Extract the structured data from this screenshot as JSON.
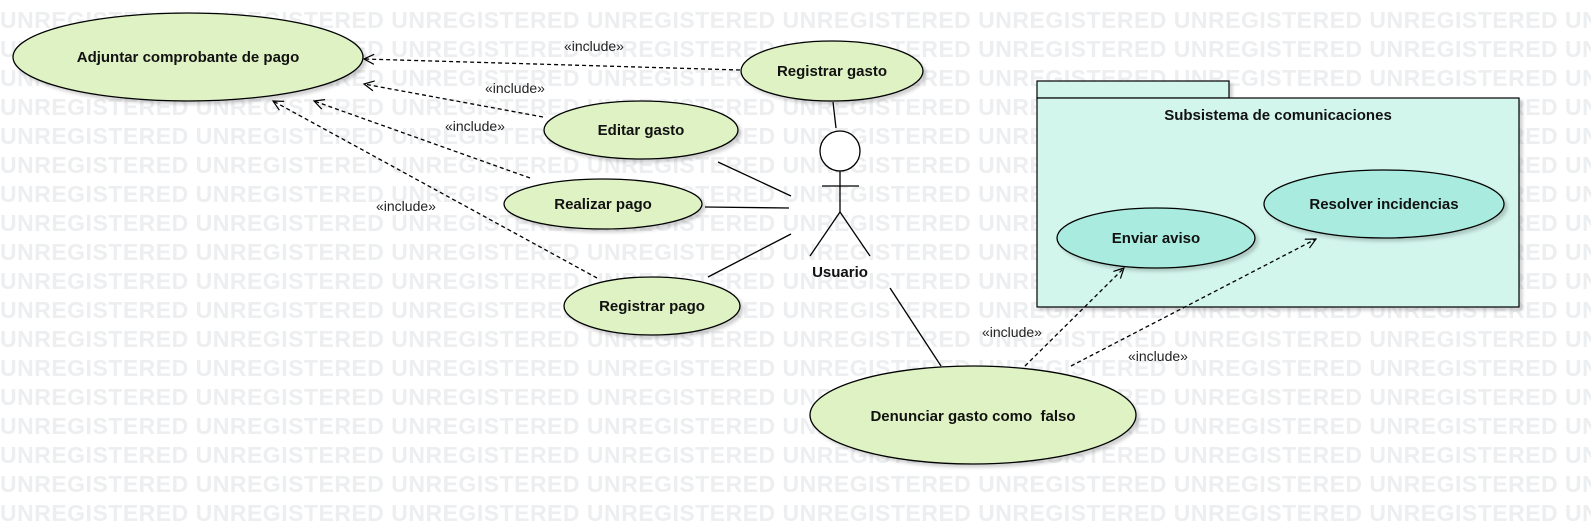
{
  "watermark": {
    "text": "UNREGISTERED UNREGISTERED UNREGISTERED UNREGISTERED UNREGISTERED UNREGISTERED UNREGISTERED UNREGISTERED UNREGISTERED"
  },
  "colors": {
    "use_case_fill": "#dff2c4",
    "subsystem_use_case_fill": "#a9ecdf",
    "package_fill": "#d2f5ec",
    "stroke": "#000000",
    "watermark": "#eceef0"
  },
  "actor": {
    "name": "Usuario"
  },
  "use_cases": {
    "adjuntar": "Adjuntar comprobante de pago",
    "registrar_gasto": "Registrar gasto",
    "editar_gasto": "Editar gasto",
    "realizar_pago": "Realizar pago",
    "registrar_pago": "Registrar pago",
    "denunciar": "Denunciar gasto como  falso",
    "enviar_aviso": "Enviar aviso",
    "resolver": "Resolver incidencias"
  },
  "package": {
    "title": "Subsistema de comunicaciones"
  },
  "include_label": "«include»"
}
